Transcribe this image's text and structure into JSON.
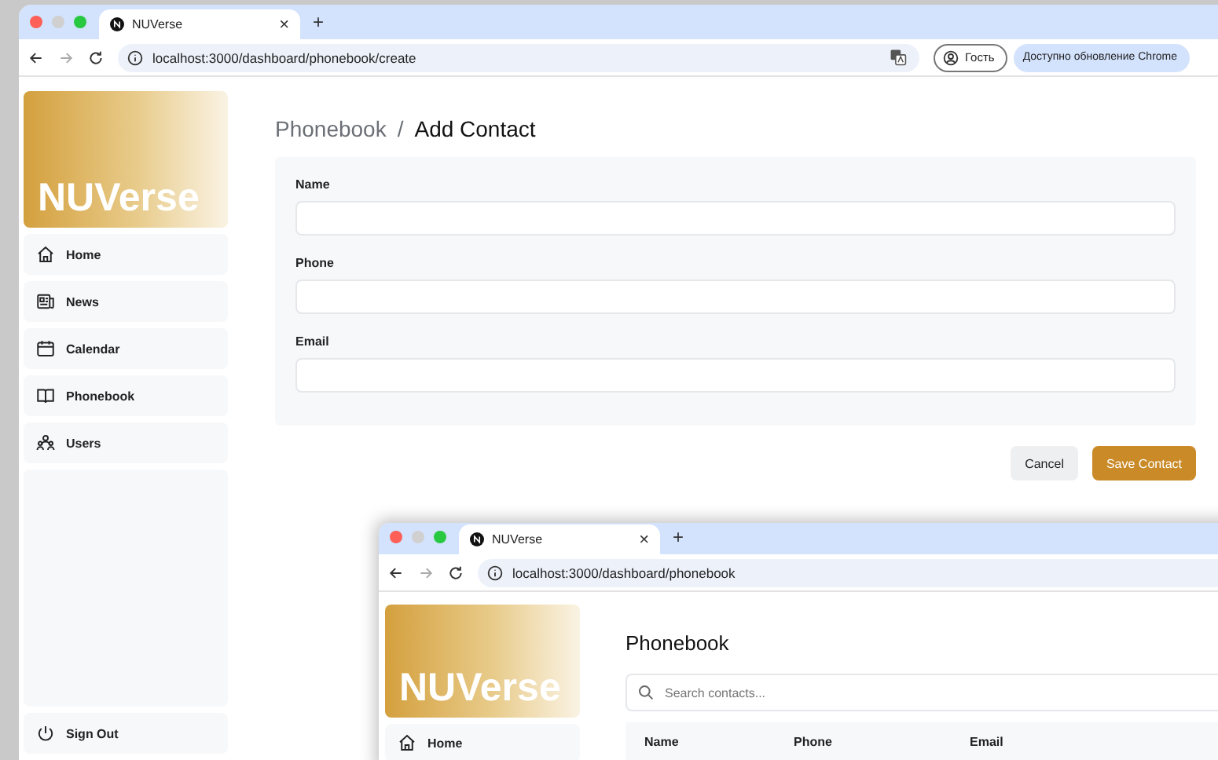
{
  "browser": {
    "tab_title": "NUVerse",
    "tab_close": "×",
    "new_tab": "+",
    "url": "localhost:3000/dashboard/phonebook/create",
    "profile": "Гость",
    "update": "Доступно обновление Chrome"
  },
  "sidebar": {
    "logo": "NUVerse",
    "items": [
      {
        "label": "Home"
      },
      {
        "label": "News"
      },
      {
        "label": "Calendar"
      },
      {
        "label": "Phonebook"
      },
      {
        "label": "Users"
      }
    ],
    "sign_out": "Sign Out"
  },
  "page": {
    "breadcrumb": {
      "parent": "Phonebook",
      "separator": "/",
      "current": "Add Contact"
    },
    "fields": [
      {
        "label": "Name"
      },
      {
        "label": "Phone"
      },
      {
        "label": "Email"
      }
    ],
    "buttons": [
      {
        "label": "Cancel",
        "kind": "secondary"
      },
      {
        "label": "Save Contact",
        "kind": "primary"
      }
    ]
  },
  "second_window": {
    "tab_title": "NUVerse",
    "tab_close": "×",
    "new_tab": "+",
    "url": "localhost:3000/dashboard/phonebook",
    "logo": "NUVerse",
    "sidebar_items": [
      {
        "label": "Home"
      }
    ],
    "title": "Phonebook",
    "search": {
      "placeholder": "Search contacts..."
    },
    "columns": [
      "Name",
      "Phone",
      "Email"
    ]
  }
}
